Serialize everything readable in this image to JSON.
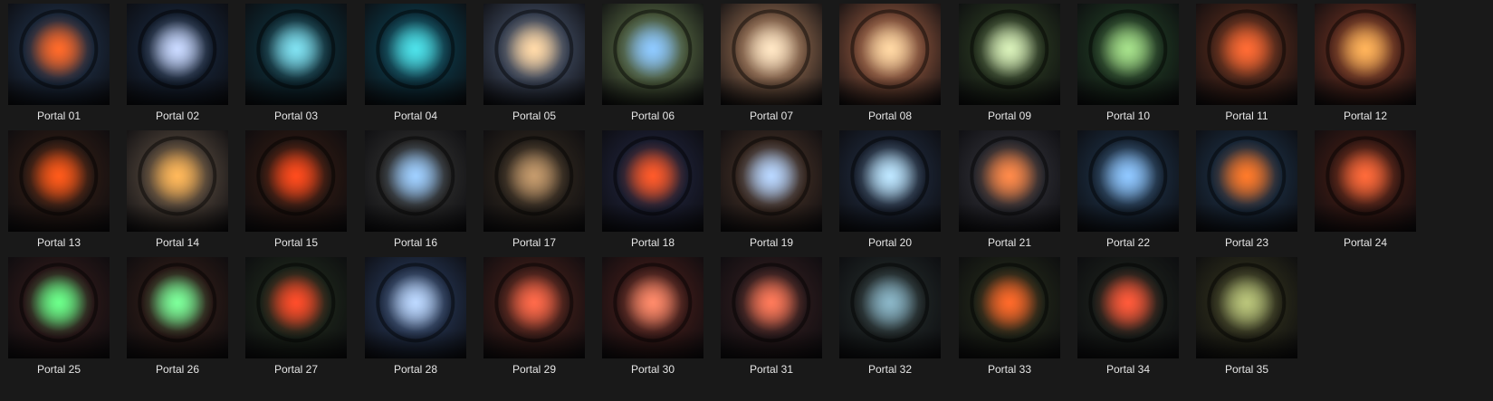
{
  "gallery": {
    "items": [
      {
        "label": "Portal 01",
        "bg": "#1c2a3e",
        "glow": "#ff6a2a",
        "icon": "image-icon"
      },
      {
        "label": "Portal 02",
        "bg": "#162234",
        "glow": "#c9d9ff",
        "icon": "image-icon"
      },
      {
        "label": "Portal 03",
        "bg": "#0e2a34",
        "glow": "#7fe0f0",
        "icon": "image-icon"
      },
      {
        "label": "Portal 04",
        "bg": "#0d3442",
        "glow": "#4de1e9",
        "icon": "image-icon"
      },
      {
        "label": "Portal 05",
        "bg": "#3a4457",
        "glow": "#ffd9a8",
        "icon": "image-icon"
      },
      {
        "label": "Portal 06",
        "bg": "#4b5a3b",
        "glow": "#8ec9ff",
        "icon": "image-icon"
      },
      {
        "label": "Portal 07",
        "bg": "#7b5a44",
        "glow": "#ffe6c4",
        "icon": "image-icon"
      },
      {
        "label": "Portal 08",
        "bg": "#7a4a36",
        "glow": "#ffd7a3",
        "icon": "image-icon"
      },
      {
        "label": "Portal 09",
        "bg": "#26331f",
        "glow": "#d8f0b9",
        "icon": "image-icon"
      },
      {
        "label": "Portal 10",
        "bg": "#1d3320",
        "glow": "#a5e08a",
        "icon": "image-icon"
      },
      {
        "label": "Portal 11",
        "bg": "#4a261a",
        "glow": "#ff6b34",
        "icon": "image-icon"
      },
      {
        "label": "Portal 12",
        "bg": "#5a2a1e",
        "glow": "#ffb35a",
        "icon": "image-icon"
      },
      {
        "label": "Portal 13",
        "bg": "#2a1a14",
        "glow": "#ff5a1a",
        "icon": "image-icon"
      },
      {
        "label": "Portal 14",
        "bg": "#4a3f36",
        "glow": "#ffb85a",
        "icon": "image-icon"
      },
      {
        "label": "Portal 15",
        "bg": "#2a1812",
        "glow": "#ff4b1d",
        "icon": "image-icon"
      },
      {
        "label": "Portal 16",
        "bg": "#2a2a2a",
        "glow": "#9fcfff",
        "icon": "image-icon"
      },
      {
        "label": "Portal 17",
        "bg": "#2a231c",
        "glow": "#c49a6c",
        "icon": "image-icon"
      },
      {
        "label": "Portal 18",
        "bg": "#1c1f33",
        "glow": "#ff5a2a",
        "icon": "image-icon"
      },
      {
        "label": "Portal 19",
        "bg": "#3a2a22",
        "glow": "#b9d7ff",
        "icon": "image-icon"
      },
      {
        "label": "Portal 20",
        "bg": "#1c2535",
        "glow": "#bde6ff",
        "icon": "image-icon"
      },
      {
        "label": "Portal 21",
        "bg": "#2a2a30",
        "glow": "#ff8a4a",
        "icon": "image-icon"
      },
      {
        "label": "Portal 22",
        "bg": "#1a2a3c",
        "glow": "#8fc7ff",
        "icon": "image-icon"
      },
      {
        "label": "Portal 23",
        "bg": "#1a2a3c",
        "glow": "#ff7a2a",
        "icon": "image-icon"
      },
      {
        "label": "Portal 24",
        "bg": "#3a1a14",
        "glow": "#ff6a3a",
        "icon": "image-icon"
      },
      {
        "label": "Portal 25",
        "bg": "#2a1818",
        "glow": "#6cff8a",
        "icon": "image-icon"
      },
      {
        "label": "Portal 26",
        "bg": "#2a1a16",
        "glow": "#7dff9a",
        "icon": "image-icon"
      },
      {
        "label": "Portal 27",
        "bg": "#1c241a",
        "glow": "#ff4d2a",
        "icon": "image-icon"
      },
      {
        "label": "Portal 28",
        "bg": "#22304a",
        "glow": "#bcd8ff",
        "icon": "image-icon"
      },
      {
        "label": "Portal 29",
        "bg": "#3a1c18",
        "glow": "#ff6a4a",
        "icon": "image-icon"
      },
      {
        "label": "Portal 30",
        "bg": "#3a1a18",
        "glow": "#ff8a6a",
        "icon": "image-icon"
      },
      {
        "label": "Portal 31",
        "bg": "#2a1a1c",
        "glow": "#ff7a5a",
        "icon": "image-icon"
      },
      {
        "label": "Portal 32",
        "bg": "#1e2424",
        "glow": "#8ab5c6",
        "icon": "image-icon"
      },
      {
        "label": "Portal 33",
        "bg": "#1f2418",
        "glow": "#ff6a2a",
        "icon": "image-icon"
      },
      {
        "label": "Portal 34",
        "bg": "#1a1e1a",
        "glow": "#ff5a3a",
        "icon": "image-icon"
      },
      {
        "label": "Portal 35",
        "bg": "#2a2a1a",
        "glow": "#b9c47a",
        "icon": "image-icon"
      }
    ]
  }
}
